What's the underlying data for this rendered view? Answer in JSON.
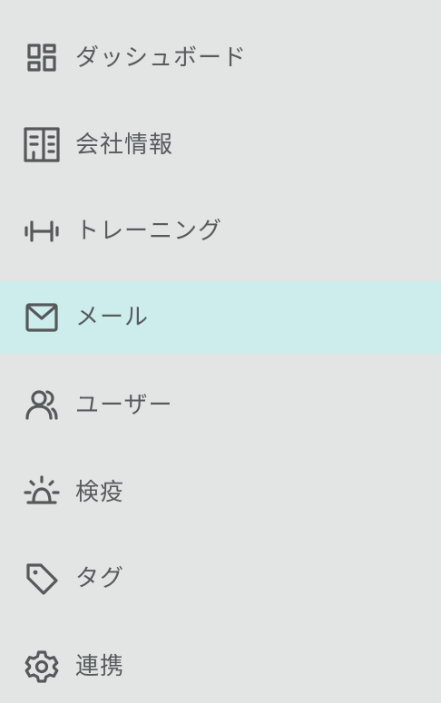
{
  "sidebar": {
    "active_item": "mail",
    "colors": {
      "background": "#e3e4e4",
      "active_background": "#cdecec",
      "text": "#575b5c",
      "icon": "#55595a"
    },
    "items": [
      {
        "key": "dashboard",
        "label": "ダッシュボード",
        "icon": "dashboard-grid-icon"
      },
      {
        "key": "company-info",
        "label": "会社情報",
        "icon": "building-icon"
      },
      {
        "key": "training",
        "label": "トレーニング",
        "icon": "dumbbell-icon"
      },
      {
        "key": "mail",
        "label": "メール",
        "icon": "envelope-icon"
      },
      {
        "key": "users",
        "label": "ユーザー",
        "icon": "users-icon"
      },
      {
        "key": "quarantine",
        "label": "検疫",
        "icon": "siren-icon"
      },
      {
        "key": "tags",
        "label": "タグ",
        "icon": "tag-icon"
      },
      {
        "key": "integrations",
        "label": "連携",
        "icon": "gear-icon"
      }
    ]
  }
}
